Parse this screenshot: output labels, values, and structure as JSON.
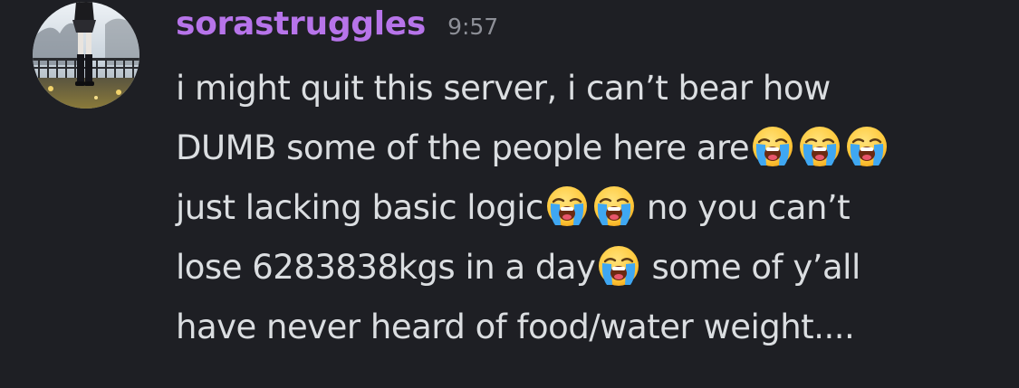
{
  "message": {
    "author": "sorastruggles",
    "timestamp": "9:57",
    "colors": {
      "background": "#1e1f24",
      "username": "#b774ea",
      "timestamp": "#8d8f97",
      "text": "#dbdee1"
    },
    "emoji_name": "loudly-crying-face",
    "lines": [
      {
        "segments": [
          "i might quit this server, i can’t bear how"
        ]
      },
      {
        "segments": [
          "DUMB some of the people here are"
        ],
        "trailing_emoji_count": 3
      },
      {
        "segments": [
          "just lacking basic logic",
          "no you can’t"
        ],
        "mid_emoji_count": 2
      },
      {
        "segments": [
          "lose 6283838kgs in a day",
          "some of y’all"
        ],
        "mid_emoji_count": 1
      },
      {
        "segments": [
          "have never heard of food/water weight...."
        ]
      }
    ]
  }
}
